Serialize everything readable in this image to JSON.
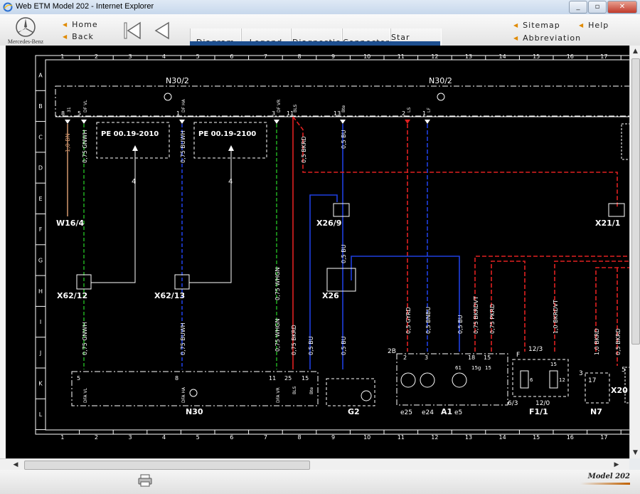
{
  "window": {
    "title": "Web ETM Model 202 - Internet Explorer",
    "minimize": "_",
    "restore": "▫",
    "close": "✕"
  },
  "brand": {
    "name": "Mercedes-Benz"
  },
  "nav": {
    "home": "Home",
    "back": "Back"
  },
  "tabs": [
    {
      "label": "Diagram",
      "active": true
    },
    {
      "label": "Legend",
      "active": false
    },
    {
      "label": "Diagnostic",
      "active": false
    },
    {
      "label": "Connector",
      "active": false
    },
    {
      "label": "Star Finder",
      "active": false
    }
  ],
  "right_links": {
    "sitemap": "Sitemap",
    "abbreviation": "Abbreviation",
    "help": "Help"
  },
  "colors": {
    "accent_tab": "#d7c000",
    "tab_bar": "#1e4f8f",
    "wire_green": "#1fa21f",
    "wire_blue": "#1f3fe0",
    "wire_red": "#e02020",
    "wire_brown": "#c8906a"
  },
  "diagram": {
    "column_numbers": [
      "1",
      "2",
      "3",
      "4",
      "5",
      "6",
      "7",
      "8",
      "9",
      "10",
      "11",
      "12",
      "13",
      "14",
      "15",
      "16",
      "17"
    ],
    "row_letters": [
      "A",
      "B",
      "C",
      "D",
      "E",
      "F",
      "G",
      "H",
      "I",
      "J",
      "K",
      "L"
    ],
    "top_labels": [
      "N30/2",
      "N30/2"
    ],
    "components": [
      "W16/4",
      "X62/12",
      "X62/13",
      "X26/9",
      "X26",
      "X21/1",
      "N30",
      "G2",
      "A1",
      "F1/1",
      "N7",
      "X20"
    ],
    "pe_refs": [
      "PE 00.19-2010",
      "PE 00.19-2100"
    ],
    "pe_arrow_nums": [
      "4",
      "4"
    ],
    "wire_labels": [
      "1,0 BN",
      "0,75 GNWH",
      "0,75 BUWH",
      "0,75 WHGN",
      "0,5 BKRD",
      "0,5 BU",
      "0,5 BU",
      "0,75 GNWH",
      "0,75 BUWH",
      "0,75 WHGN",
      "0,75 BKRD",
      "0,5 BU",
      "0,5 BU",
      "0,5 GYRD",
      "0,5 BNBU",
      "0,5 BU",
      "0,75 BKRDVT",
      "0,75 PKRD",
      "1,0 BKRDVT",
      "1,0 BKRD",
      "0,5 BKRD"
    ],
    "pin_labels": [
      "8",
      "5",
      "1",
      "3",
      "11",
      "13",
      "2",
      "1",
      "5",
      "8",
      "11",
      "25",
      "15",
      "2",
      "3",
      "18",
      "15",
      "12/3",
      "15",
      "17",
      "5"
    ],
    "pin_codes_top": [
      "31",
      "DF VL",
      "DF HA",
      "DF VR",
      "BLS",
      "Bte",
      "LS",
      "LF"
    ],
    "pin_codes_bottom": [
      "DFA VL",
      "DFA HA",
      "DFA VR",
      "BLS",
      "Bte"
    ],
    "a1_pins": [
      "e25",
      "e24",
      "e5",
      "2B",
      "61",
      "15g",
      "15"
    ],
    "fuse_labels": [
      "F",
      "6/3",
      "12/0",
      "6",
      "12",
      "3"
    ]
  },
  "footer": {
    "model": "Model 202"
  }
}
